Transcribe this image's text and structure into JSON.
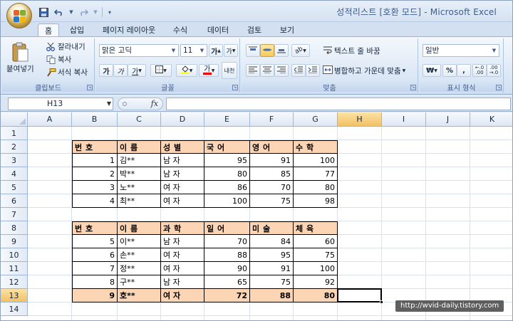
{
  "window": {
    "title": "성적리스트  [호환 모드] - Microsoft Excel"
  },
  "tabs": [
    {
      "label": "홈",
      "active": true
    },
    {
      "label": "삽입"
    },
    {
      "label": "페이지 레이아웃"
    },
    {
      "label": "수식"
    },
    {
      "label": "데이터"
    },
    {
      "label": "검토"
    },
    {
      "label": "보기"
    }
  ],
  "ribbon": {
    "clipboard": {
      "paste": "붙여넣기",
      "cut": "잘라내기",
      "copy": "복사",
      "format_painter": "서식 복사",
      "label": "클립보드"
    },
    "font": {
      "name": "맑은 고딕",
      "size": "11",
      "grow": "가",
      "shrink": "가",
      "bold": "가",
      "italic": "가",
      "underline": "가",
      "color_char": "가",
      "phonetic": "내천",
      "label": "글꼴"
    },
    "alignment": {
      "wrap": "텍스트 줄 바꿈",
      "merge": "병합하고 가운데 맞춤",
      "label": "맞춤"
    },
    "number": {
      "format": "일반",
      "currency": "₩",
      "percent": "%",
      "comma": ",",
      "label": "표시 형식"
    }
  },
  "formula_bar": {
    "name_box": "H13",
    "fx": "fx",
    "value": ""
  },
  "columns": [
    "A",
    "B",
    "C",
    "D",
    "E",
    "F",
    "G",
    "H",
    "I",
    "J",
    "K"
  ],
  "rows": [
    "1",
    "2",
    "3",
    "4",
    "5",
    "6",
    "7",
    "8",
    "9",
    "10",
    "11",
    "12",
    "13",
    "14"
  ],
  "selected": {
    "col": "H",
    "row": "13"
  },
  "table1": {
    "headers": [
      "번  호",
      "이    름",
      "성   별",
      "국   어",
      "영    어",
      "수    학"
    ],
    "rows": [
      [
        "1",
        "김**",
        "남 자",
        "95",
        "91",
        "100"
      ],
      [
        "2",
        "박**",
        "남 자",
        "80",
        "85",
        "77"
      ],
      [
        "3",
        "노**",
        "여 자",
        "86",
        "70",
        "80"
      ],
      [
        "4",
        "최**",
        "여 자",
        "100",
        "75",
        "98"
      ]
    ]
  },
  "table2": {
    "headers": [
      "번  호",
      "이    름",
      "과  학",
      "일  어",
      "미  술",
      "체  육"
    ],
    "rows": [
      [
        "5",
        "이**",
        "남 자",
        "70",
        "84",
        "60"
      ],
      [
        "6",
        "손**",
        "여 자",
        "88",
        "95",
        "75"
      ],
      [
        "7",
        "정**",
        "여 자",
        "90",
        "91",
        "100"
      ],
      [
        "8",
        "구**",
        "남 자",
        "65",
        "75",
        "92"
      ],
      [
        "9",
        "호**",
        "여 자",
        "72",
        "88",
        "80"
      ]
    ]
  },
  "watermark": "http://wvid-daily.tistory.com",
  "colors": {
    "header_fill": "#fcd5b4",
    "selection_header": "#f3c064"
  }
}
